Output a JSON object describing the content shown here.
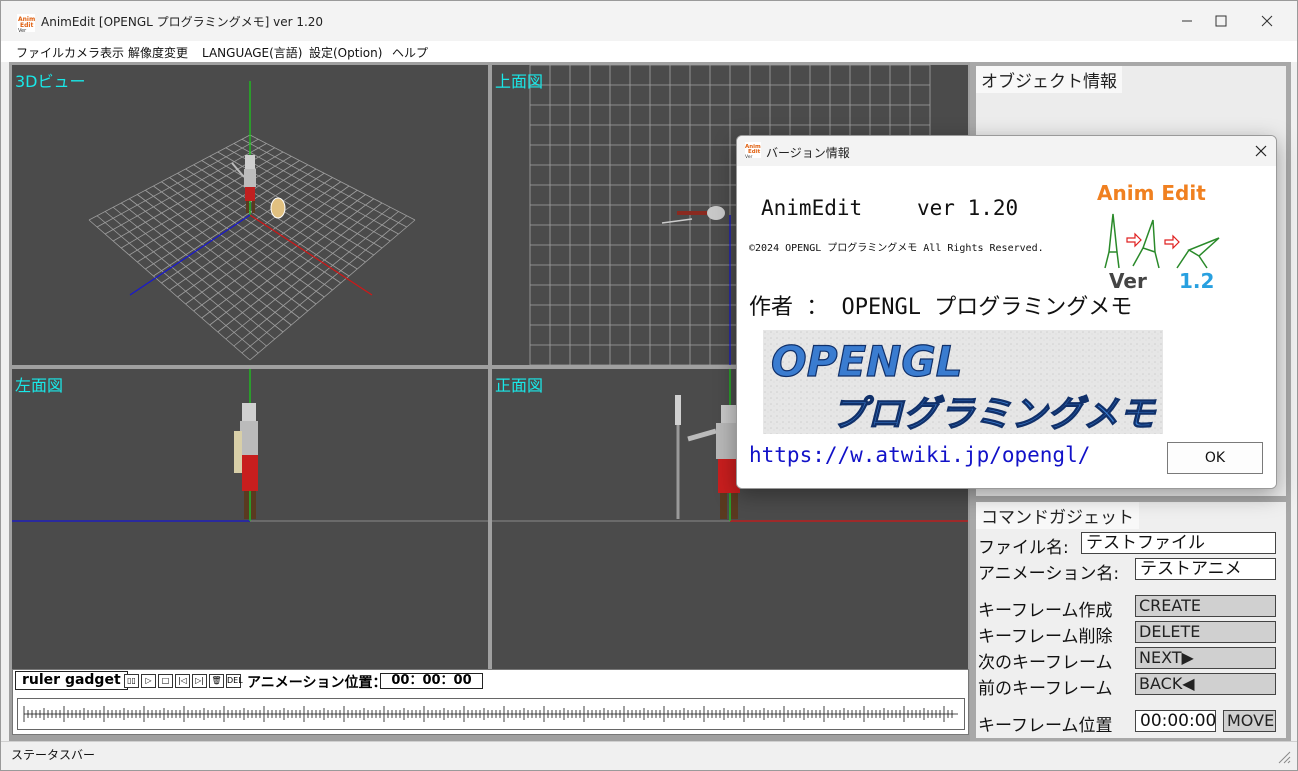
{
  "window": {
    "title": "AnimEdit [OPENGL プログラミングメモ] ver 1.20",
    "icon_text": "Anim Edit"
  },
  "menu": [
    "ファイル",
    "カメラ表示",
    "解像度変更",
    "LANGUAGE(言語)",
    "設定(Option)",
    "ヘルプ"
  ],
  "viewports": {
    "v3d": "3Dビュー",
    "top": "上面図",
    "left": "左面図",
    "front": "正面図"
  },
  "object_panel": {
    "title": "オブジェクト情報"
  },
  "command_panel": {
    "title": "コマンドガジェット",
    "file_label": "ファイル名:",
    "file_value": "テストファイル",
    "anim_label": "アニメーション名:",
    "anim_value": "テストアニメ",
    "create_label": "キーフレーム作成",
    "create_btn": "CREATE",
    "delete_label": "キーフレーム削除",
    "delete_btn": "DELETE",
    "next_label": "次のキーフレーム",
    "next_btn": "NEXT▶",
    "back_label": "前のキーフレーム",
    "back_btn": "BACK◀",
    "pos_label": "キーフレーム位置",
    "pos_value": "00:00:00",
    "move_btn": "MOVE"
  },
  "ruler": {
    "tab": "ruler gadget",
    "buttons": [
      "▯▯",
      "▷",
      "□",
      "|◁",
      "▷|",
      "🗑",
      "DEL"
    ],
    "anim_pos_label": "アニメーション位置：",
    "anim_pos_value": "00：00：00"
  },
  "statusbar": {
    "text": "ステータスバー"
  },
  "dialog": {
    "title": "バージョン情報",
    "app_name": "AnimEdit",
    "version": "ver 1.20",
    "copyright": "©2024 OPENGL プログラミングメモ All Rights Reserved.",
    "author": "作者 ： OPENGL プログラミングメモ",
    "banner_line1": "OPENGL",
    "banner_line2": "プログラミングメモ",
    "url": "https://w.atwiki.jp/opengl/",
    "ok": "OK",
    "logo_title": "Anim Edit",
    "logo_ver": "Ver",
    "logo_num": "1.2"
  }
}
